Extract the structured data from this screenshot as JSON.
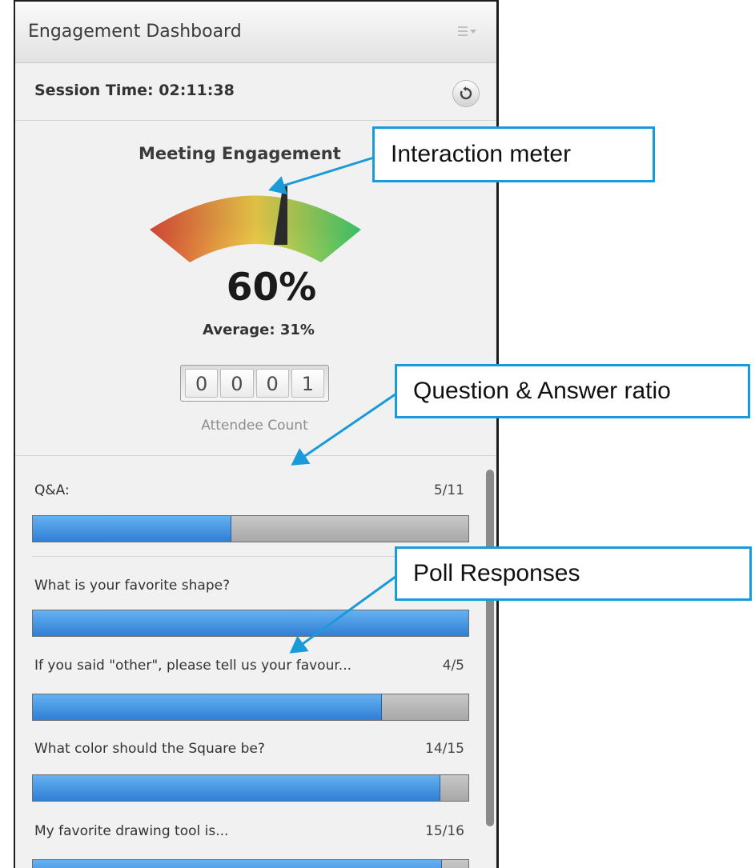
{
  "panel": {
    "title": "Engagement Dashboard",
    "session_label": "Session Time:",
    "session_time": "02:11:38"
  },
  "meter": {
    "title": "Meeting Engagement",
    "value": 0.6,
    "percent_text": "60%",
    "average_text": "Average: 31%"
  },
  "attendee": {
    "digits": [
      "0",
      "0",
      "0",
      "1"
    ],
    "label": "Attendee Count"
  },
  "rows": [
    {
      "label": "Q&A:",
      "value_text": "5/11",
      "fraction": 0.4545
    },
    {
      "label": "What is your favorite shape?",
      "value_text": "",
      "fraction": 1.0
    },
    {
      "label": "If you said \"other\", please tell us your favour...",
      "value_text": "4/5",
      "fraction": 0.8
    },
    {
      "label": "What color should the Square be?",
      "value_text": "14/15",
      "fraction": 0.9333
    },
    {
      "label": "My favorite drawing tool is...",
      "value_text": "15/16",
      "fraction": 0.9375
    }
  ],
  "callouts": {
    "interaction": "Interaction meter",
    "qa_ratio": "Question & Answer ratio",
    "poll": "Poll Responses"
  },
  "colors": {
    "callout_border": "#1a9ad8",
    "bar_fill": "#3c8ee0",
    "bar_track": "#b4b4b4",
    "gauge_low": "#e04a3a",
    "gauge_mid": "#f2d04a",
    "gauge_high": "#3fcf6d"
  },
  "icons": [
    "panel-menu-icon",
    "refresh-icon"
  ]
}
